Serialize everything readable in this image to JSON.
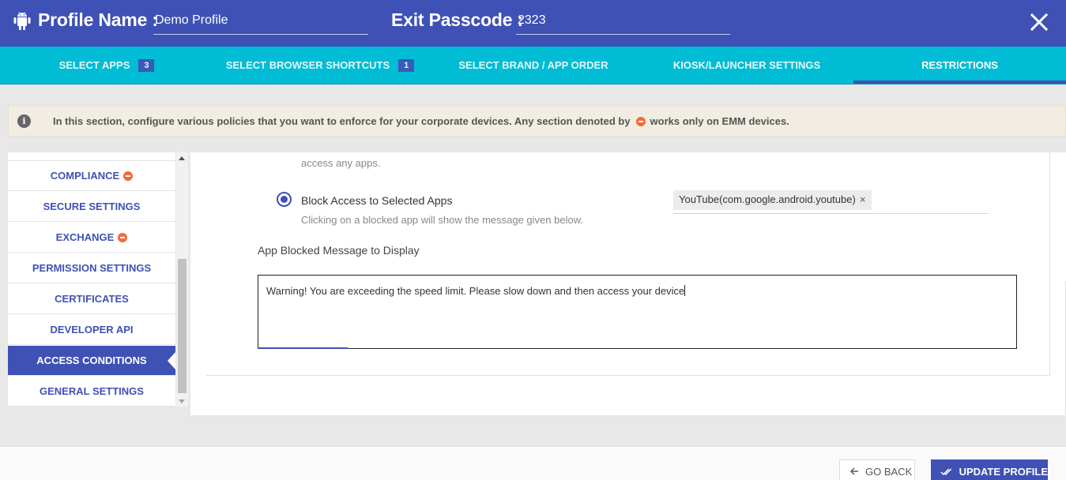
{
  "header": {
    "profile_label": "Profile Name :",
    "profile_value": "Demo Profile",
    "passcode_label": "Exit Passcode :",
    "passcode_value": "2323"
  },
  "tabs": [
    {
      "label": "SELECT APPS",
      "badge": "3"
    },
    {
      "label": "SELECT BROWSER SHORTCUTS",
      "badge": "1"
    },
    {
      "label": "SELECT BRAND / APP ORDER"
    },
    {
      "label": "KIOSK/LAUNCHER SETTINGS"
    },
    {
      "label": "RESTRICTIONS",
      "active": true
    }
  ],
  "info": {
    "text_before": "In this section, configure various policies that you want to enforce for your corporate devices. Any section denoted by",
    "text_after": "works only on EMM devices."
  },
  "sidebar": {
    "items": [
      {
        "label": "COMPLIANCE",
        "emm": true
      },
      {
        "label": "SECURE SETTINGS"
      },
      {
        "label": "EXCHANGE",
        "emm": true
      },
      {
        "label": "PERMISSION SETTINGS"
      },
      {
        "label": "CERTIFICATES"
      },
      {
        "label": "DEVELOPER API"
      },
      {
        "label": "ACCESS CONDITIONS",
        "active": true
      },
      {
        "label": "GENERAL SETTINGS"
      }
    ]
  },
  "main": {
    "partial_text": "access any apps.",
    "block_option_label": "Block Access to Selected Apps",
    "block_option_hint": "Clicking on a blocked app will show the message given below.",
    "blocked_app_chip": "YouTube(com.google.android.youtube)",
    "chip_remove": "×",
    "message_label": "App Blocked Message to Display",
    "message_value": "Warning! You are exceeding the speed limit. Please slow down and then access your device"
  },
  "footer": {
    "back_label": "GO BACK",
    "update_label": "UPDATE PROFILE"
  },
  "colors": {
    "primary": "#3f51b5",
    "tab_bar": "#00bcd4",
    "emm_badge": "#f26b3a",
    "banner": "#f1ede2"
  },
  "icons": [
    "android-icon",
    "close-icon",
    "info-icon",
    "emm-icon",
    "arrow-left-icon",
    "double-check-icon"
  ]
}
